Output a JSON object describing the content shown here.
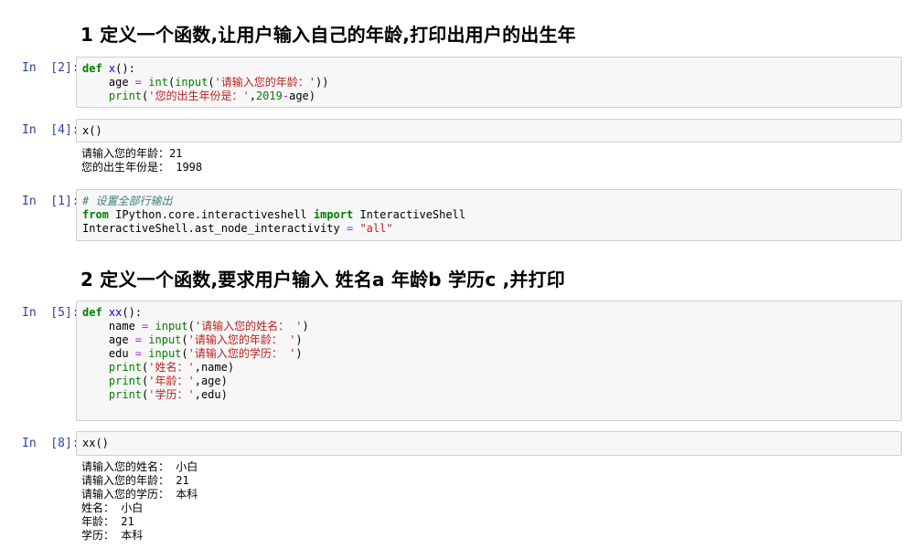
{
  "headings": [
    "1 定义一个函数,让用户输入自己的年龄,打印出用户的出生年",
    "2 定义一个函数,要求用户输入 姓名a 年龄b 学历c ,并打印"
  ],
  "cells": [
    {
      "prompt": "In  [2]:",
      "lines": [
        [
          {
            "t": "def",
            "c": "kw"
          },
          {
            "t": " "
          },
          {
            "t": "x",
            "c": "fn"
          },
          {
            "t": "():"
          }
        ],
        [
          {
            "t": "    age "
          },
          {
            "t": "=",
            "c": "op"
          },
          {
            "t": " "
          },
          {
            "t": "int",
            "c": "bi"
          },
          {
            "t": "("
          },
          {
            "t": "input",
            "c": "bi"
          },
          {
            "t": "("
          },
          {
            "t": "'请输入您的年龄：'",
            "c": "str"
          },
          {
            "t": "))"
          }
        ],
        [
          {
            "t": "    "
          },
          {
            "t": "print",
            "c": "bi"
          },
          {
            "t": "("
          },
          {
            "t": "'您的出生年份是：'",
            "c": "str"
          },
          {
            "t": ","
          },
          {
            "t": "2019",
            "c": "num"
          },
          {
            "t": "-",
            "c": "op"
          },
          {
            "t": "age)"
          }
        ]
      ]
    },
    {
      "prompt": "In  [4]:",
      "lines": [
        [
          {
            "t": "x()"
          }
        ]
      ],
      "output": [
        "请输入您的年龄：21",
        "您的出生年份是： 1998"
      ]
    },
    {
      "prompt": "In  [1]:",
      "lines": [
        [
          {
            "t": "# 设置全部行输出",
            "c": "cm"
          }
        ],
        [
          {
            "t": "from",
            "c": "kw"
          },
          {
            "t": " IPython.core.interactiveshell "
          },
          {
            "t": "import",
            "c": "kw"
          },
          {
            "t": " InteractiveShell"
          }
        ],
        [
          {
            "t": "InteractiveShell.ast_node_interactivity "
          },
          {
            "t": "=",
            "c": "op"
          },
          {
            "t": " "
          },
          {
            "t": "\"all\"",
            "c": "str"
          }
        ]
      ]
    },
    {
      "prompt": "In  [5]:",
      "lines": [
        [
          {
            "t": "def",
            "c": "kw"
          },
          {
            "t": " "
          },
          {
            "t": "xx",
            "c": "fn"
          },
          {
            "t": "():"
          }
        ],
        [
          {
            "t": "    name "
          },
          {
            "t": "=",
            "c": "op"
          },
          {
            "t": " "
          },
          {
            "t": "input",
            "c": "bi"
          },
          {
            "t": "("
          },
          {
            "t": "'请输入您的姓名： '",
            "c": "str"
          },
          {
            "t": ")"
          }
        ],
        [
          {
            "t": "    age "
          },
          {
            "t": "=",
            "c": "op"
          },
          {
            "t": " "
          },
          {
            "t": "input",
            "c": "bi"
          },
          {
            "t": "("
          },
          {
            "t": "'请输入您的年龄： '",
            "c": "str"
          },
          {
            "t": ")"
          }
        ],
        [
          {
            "t": "    edu "
          },
          {
            "t": "=",
            "c": "op"
          },
          {
            "t": " "
          },
          {
            "t": "input",
            "c": "bi"
          },
          {
            "t": "("
          },
          {
            "t": "'请输入您的学历： '",
            "c": "str"
          },
          {
            "t": ")"
          }
        ],
        [
          {
            "t": "    "
          },
          {
            "t": "print",
            "c": "bi"
          },
          {
            "t": "("
          },
          {
            "t": "'姓名：'",
            "c": "str"
          },
          {
            "t": ",name)"
          }
        ],
        [
          {
            "t": "    "
          },
          {
            "t": "print",
            "c": "bi"
          },
          {
            "t": "("
          },
          {
            "t": "'年龄：'",
            "c": "str"
          },
          {
            "t": ",age)"
          }
        ],
        [
          {
            "t": "    "
          },
          {
            "t": "print",
            "c": "bi"
          },
          {
            "t": "("
          },
          {
            "t": "'学历：'",
            "c": "str"
          },
          {
            "t": ",edu)"
          }
        ]
      ]
    },
    {
      "prompt": "In  [8]:",
      "lines": [
        [
          {
            "t": "xx()"
          }
        ]
      ],
      "output": [
        "请输入您的姓名： 小白",
        "请输入您的年龄： 21",
        "请输入您的学历： 本科",
        "姓名： 小白",
        "年龄： 21",
        "学历： 本科"
      ]
    }
  ]
}
